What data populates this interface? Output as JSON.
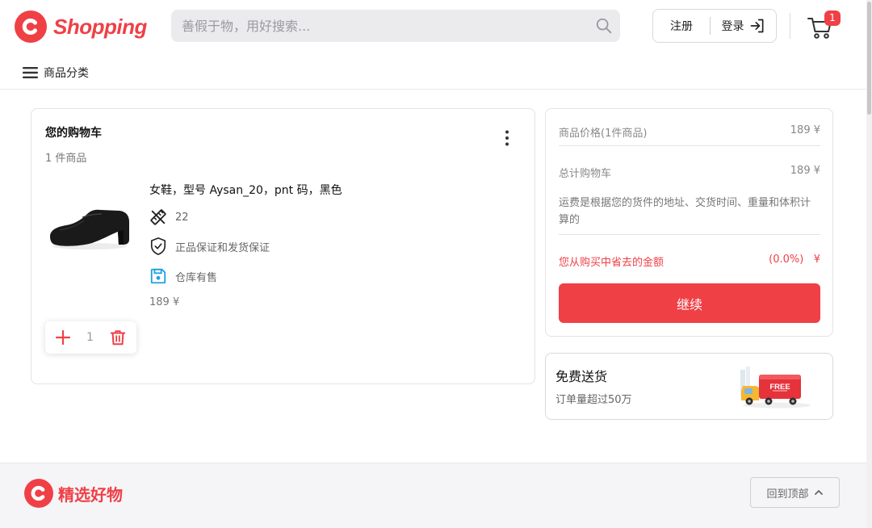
{
  "header": {
    "brand": "Shopping",
    "search_placeholder": "善假于物，用好搜索...",
    "signup_label": "注册",
    "login_label": "登录",
    "cart_badge": "1",
    "categories_label": "商品分类"
  },
  "cart": {
    "title": "您的购物车",
    "item_count": "1 件商品",
    "product": {
      "name": "女鞋，型号 Aysan_20，pnt 码，黑色",
      "size": "22",
      "guarantee": "正品保证和发货保证",
      "stock": "仓库有售",
      "price": "189 ¥",
      "quantity": "1"
    }
  },
  "summary": {
    "items_price_label": "商品价格(1件商品)",
    "items_price_value": "189 ¥",
    "total_label": "总计购物车",
    "total_value": "189 ¥",
    "shipping_note": "运费是根据您的货件的地址、交货时间、重量和体积计算的",
    "savings_label": "您从购买中省去的金额",
    "savings_value": "(0.0%)   ¥",
    "continue_label": "继续"
  },
  "free_shipping": {
    "title": "免费送货",
    "subtitle": "订单量超过50万",
    "truck_text": "FREE"
  },
  "footer": {
    "brand": "精选好物",
    "back_to_top": "回到顶部"
  },
  "colors": {
    "accent": "#ef4046",
    "stock_icon": "#1ea1e0"
  },
  "icons": {
    "search": "search-icon",
    "login": "login-arrow-icon",
    "cart": "cart-icon",
    "menu": "menu-icon",
    "more": "more-vertical-icon",
    "size": "ruler-icon",
    "guarantee": "shield-check-icon",
    "stock": "save-icon",
    "plus": "plus-icon",
    "trash": "trash-icon",
    "truck": "truck-icon",
    "back_top": "chevron-up-icon"
  }
}
